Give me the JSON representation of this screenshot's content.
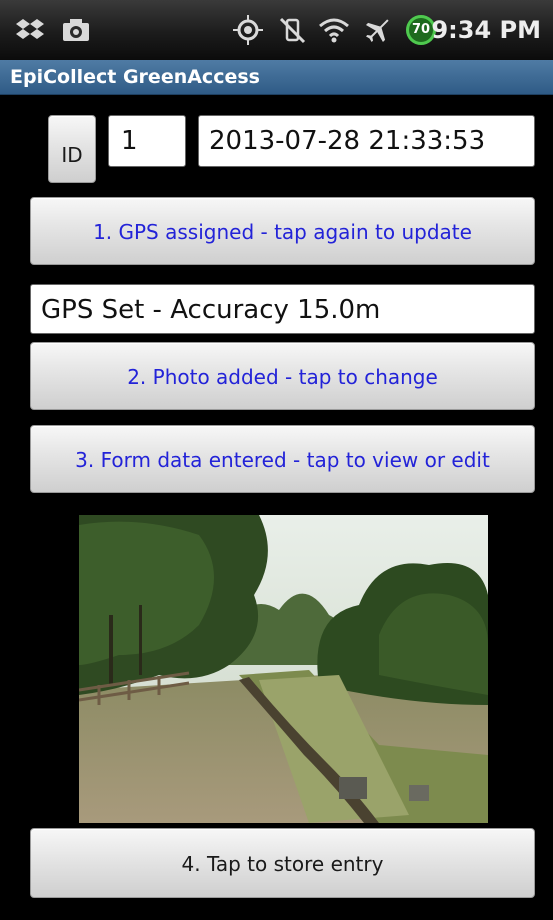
{
  "status_bar": {
    "time": "9:34 PM",
    "battery_level": "70",
    "icons": [
      "dropbox-icon",
      "camera-icon",
      "gps-icon",
      "vibrate-off-icon",
      "wifi-icon",
      "airplane-mode-icon",
      "battery-icon"
    ]
  },
  "app": {
    "title": "EpiCollect GreenAccess"
  },
  "form": {
    "id_button_label": "ID",
    "id_value": "1",
    "datetime_value": "2013-07-28 21:33:53",
    "gps_button_label": "1. GPS assigned - tap again to update",
    "gps_status_value": "GPS Set - Accuracy 15.0m",
    "photo_button_label": "2. Photo added - tap to change",
    "form_button_label": "3. Form data entered - tap to view or edit",
    "store_button_label": "4. Tap to store entry"
  },
  "colors": {
    "action_text": "#2323d8",
    "title_bar": "#3e6a96",
    "background": "#000000"
  }
}
